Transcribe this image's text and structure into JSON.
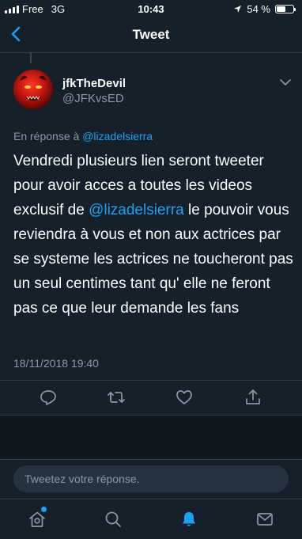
{
  "status_bar": {
    "carrier": "Free",
    "network": "3G",
    "time": "10:43",
    "battery_percent": "54 %",
    "battery_level": 0.54
  },
  "nav": {
    "title": "Tweet"
  },
  "tweet": {
    "display_name": "jfkTheDevil",
    "handle": "@JFKvsED",
    "reply_prefix": "En réponse à",
    "reply_mention": "@lizadelsierra",
    "text_before": "Vendredi plusieurs lien seront tweeter pour avoir acces a toutes les videos exclusif de",
    "text_mention": "@lizadelsierra",
    "text_after": "  le pouvoir vous reviendra à vous et non aux actrices par se systeme les actrices ne toucheront pas un seul centimes tant qu' elle ne feront pas ce que leur demande les fans",
    "timestamp": "18/11/2018 19:40"
  },
  "actions": [
    {
      "name": "reply-icon"
    },
    {
      "name": "retweet-icon"
    },
    {
      "name": "like-icon"
    },
    {
      "name": "share-icon"
    }
  ],
  "reply_bar": {
    "placeholder": "Tweetez votre réponse."
  },
  "tabs": [
    {
      "name": "home-icon"
    },
    {
      "name": "search-icon"
    },
    {
      "name": "notifications-bell-icon"
    },
    {
      "name": "messages-icon"
    }
  ],
  "colors": {
    "background": "#15202b",
    "accent": "#1da1f2",
    "secondary_text": "#8899a6"
  }
}
